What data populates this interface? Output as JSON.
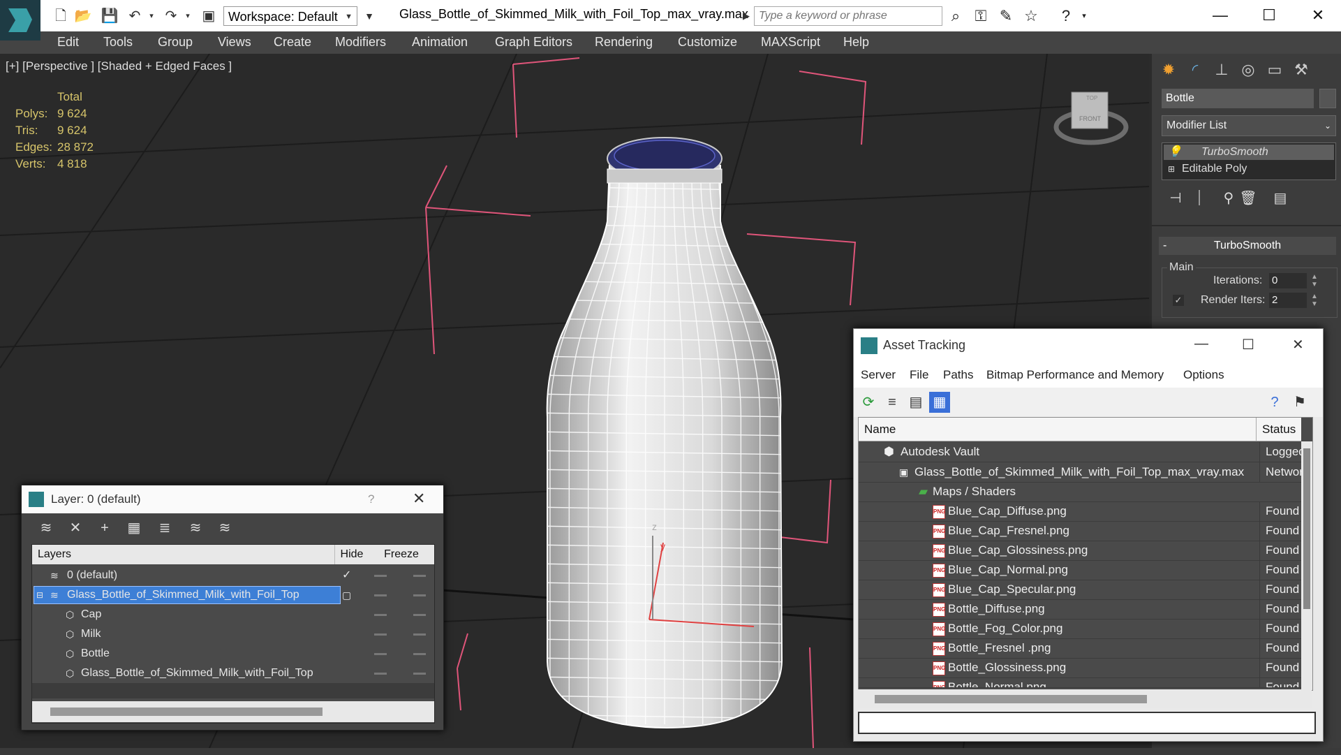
{
  "app": {
    "workspace_label": "Workspace: Default",
    "file_title": "Glass_Bottle_of_Skimmed_Milk_with_Foil_Top_max_vray.max",
    "search_placeholder": "Type a keyword or phrase"
  },
  "menu": [
    "Edit",
    "Tools",
    "Group",
    "Views",
    "Create",
    "Modifiers",
    "Animation",
    "Graph Editors",
    "Rendering",
    "Customize",
    "MAXScript",
    "Help"
  ],
  "viewport": {
    "label": "[+] [Perspective ] [Shaded + Edged Faces ]",
    "stats_header": "Total",
    "stats": [
      {
        "label": "Polys:",
        "value": "9 624"
      },
      {
        "label": "Tris:",
        "value": "9 624"
      },
      {
        "label": "Edges:",
        "value": "28 872"
      },
      {
        "label": "Verts:",
        "value": "4 818"
      }
    ],
    "viewcube_top": "TOP",
    "viewcube_front": "FRONT",
    "axis_z": "z",
    "axis_y": "y"
  },
  "command_panel": {
    "object_name": "Bottle",
    "modifier_list": "Modifier List",
    "stack": [
      "TurboSmooth",
      "Editable Poly"
    ],
    "rollout_title": "TurboSmooth",
    "rollout_minus": "-",
    "group_main": "Main",
    "iterations_label": "Iterations:",
    "iterations_value": "0",
    "render_iters_label": "Render Iters:",
    "render_iters_value": "2"
  },
  "layer_window": {
    "title": "Layer: 0 (default)",
    "help": "?",
    "columns": {
      "layers": "Layers",
      "hide": "Hide",
      "freeze": "Freeze"
    },
    "rows": [
      {
        "name": "0 (default)"
      },
      {
        "name": "Glass_Bottle_of_Skimmed_Milk_with_Foil_Top"
      },
      {
        "name": "Cap"
      },
      {
        "name": "Milk"
      },
      {
        "name": "Bottle"
      },
      {
        "name": "Glass_Bottle_of_Skimmed_Milk_with_Foil_Top"
      }
    ]
  },
  "asset_window": {
    "title": "Asset Tracking",
    "menu": [
      "Server",
      "File",
      "Paths",
      "Bitmap Performance and Memory",
      "Options"
    ],
    "columns": {
      "name": "Name",
      "status": "Status"
    },
    "rows": [
      {
        "name": "Autodesk Vault",
        "status": "Logged"
      },
      {
        "name": "Glass_Bottle_of_Skimmed_Milk_with_Foil_Top_max_vray.max",
        "status": "Networ"
      },
      {
        "name": "Maps / Shaders",
        "status": ""
      },
      {
        "name": "Blue_Cap_Diffuse.png",
        "status": "Found"
      },
      {
        "name": "Blue_Cap_Fresnel.png",
        "status": "Found"
      },
      {
        "name": "Blue_Cap_Glossiness.png",
        "status": "Found"
      },
      {
        "name": "Blue_Cap_Normal.png",
        "status": "Found"
      },
      {
        "name": "Blue_Cap_Specular.png",
        "status": "Found"
      },
      {
        "name": "Bottle_Diffuse.png",
        "status": "Found"
      },
      {
        "name": "Bottle_Fog_Color.png",
        "status": "Found"
      },
      {
        "name": "Bottle_Fresnel .png",
        "status": "Found"
      },
      {
        "name": "Bottle_Glossiness.png",
        "status": "Found"
      },
      {
        "name": "Bottle_Normal.png",
        "status": "Found"
      }
    ]
  },
  "colors": {
    "accent": "#3a6fd8",
    "selection": "#3d7fd6",
    "stats": "#d6c46a",
    "bbox": "#e0557a"
  }
}
